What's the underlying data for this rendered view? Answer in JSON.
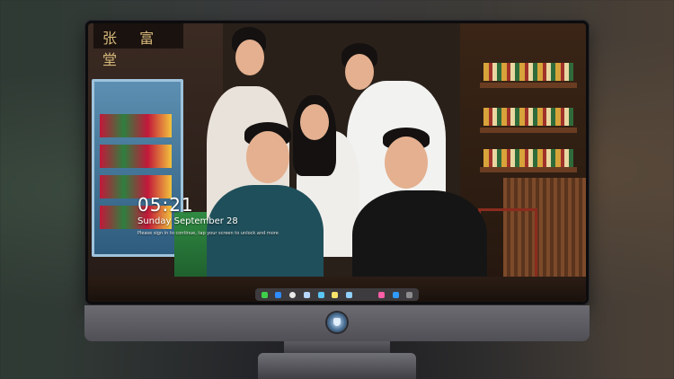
{
  "lockscreen": {
    "time": "05:21",
    "date": "Sunday September 28",
    "subtitle": "Please sign in to continue, tap your screen to unlock  and more"
  },
  "wallpaper": {
    "sign_text": "张 富 堂"
  },
  "dock": {
    "items": [
      {
        "name": "messages-icon",
        "color": "#3ecf4a"
      },
      {
        "name": "finder-icon",
        "color": "#2f8cff"
      },
      {
        "name": "safari-icon",
        "color": "#e8e8e8"
      },
      {
        "name": "files-icon",
        "color": "#b7d7ff"
      },
      {
        "name": "photos-app-icon",
        "color": "#59c6f5"
      },
      {
        "name": "notes-icon",
        "color": "#f8e36a"
      },
      {
        "name": "preview-icon",
        "color": "#8fd0ff"
      },
      {
        "name": "music-icon",
        "color": "#ff5ea8"
      },
      {
        "name": "app-store-icon",
        "color": "#2e9bff"
      },
      {
        "name": "camera-icon",
        "color": "#8c8c8c"
      }
    ]
  },
  "colors": {
    "accent": "#2f8cff",
    "bezel": "#0c0c0e",
    "stand": "#5b5b61"
  }
}
